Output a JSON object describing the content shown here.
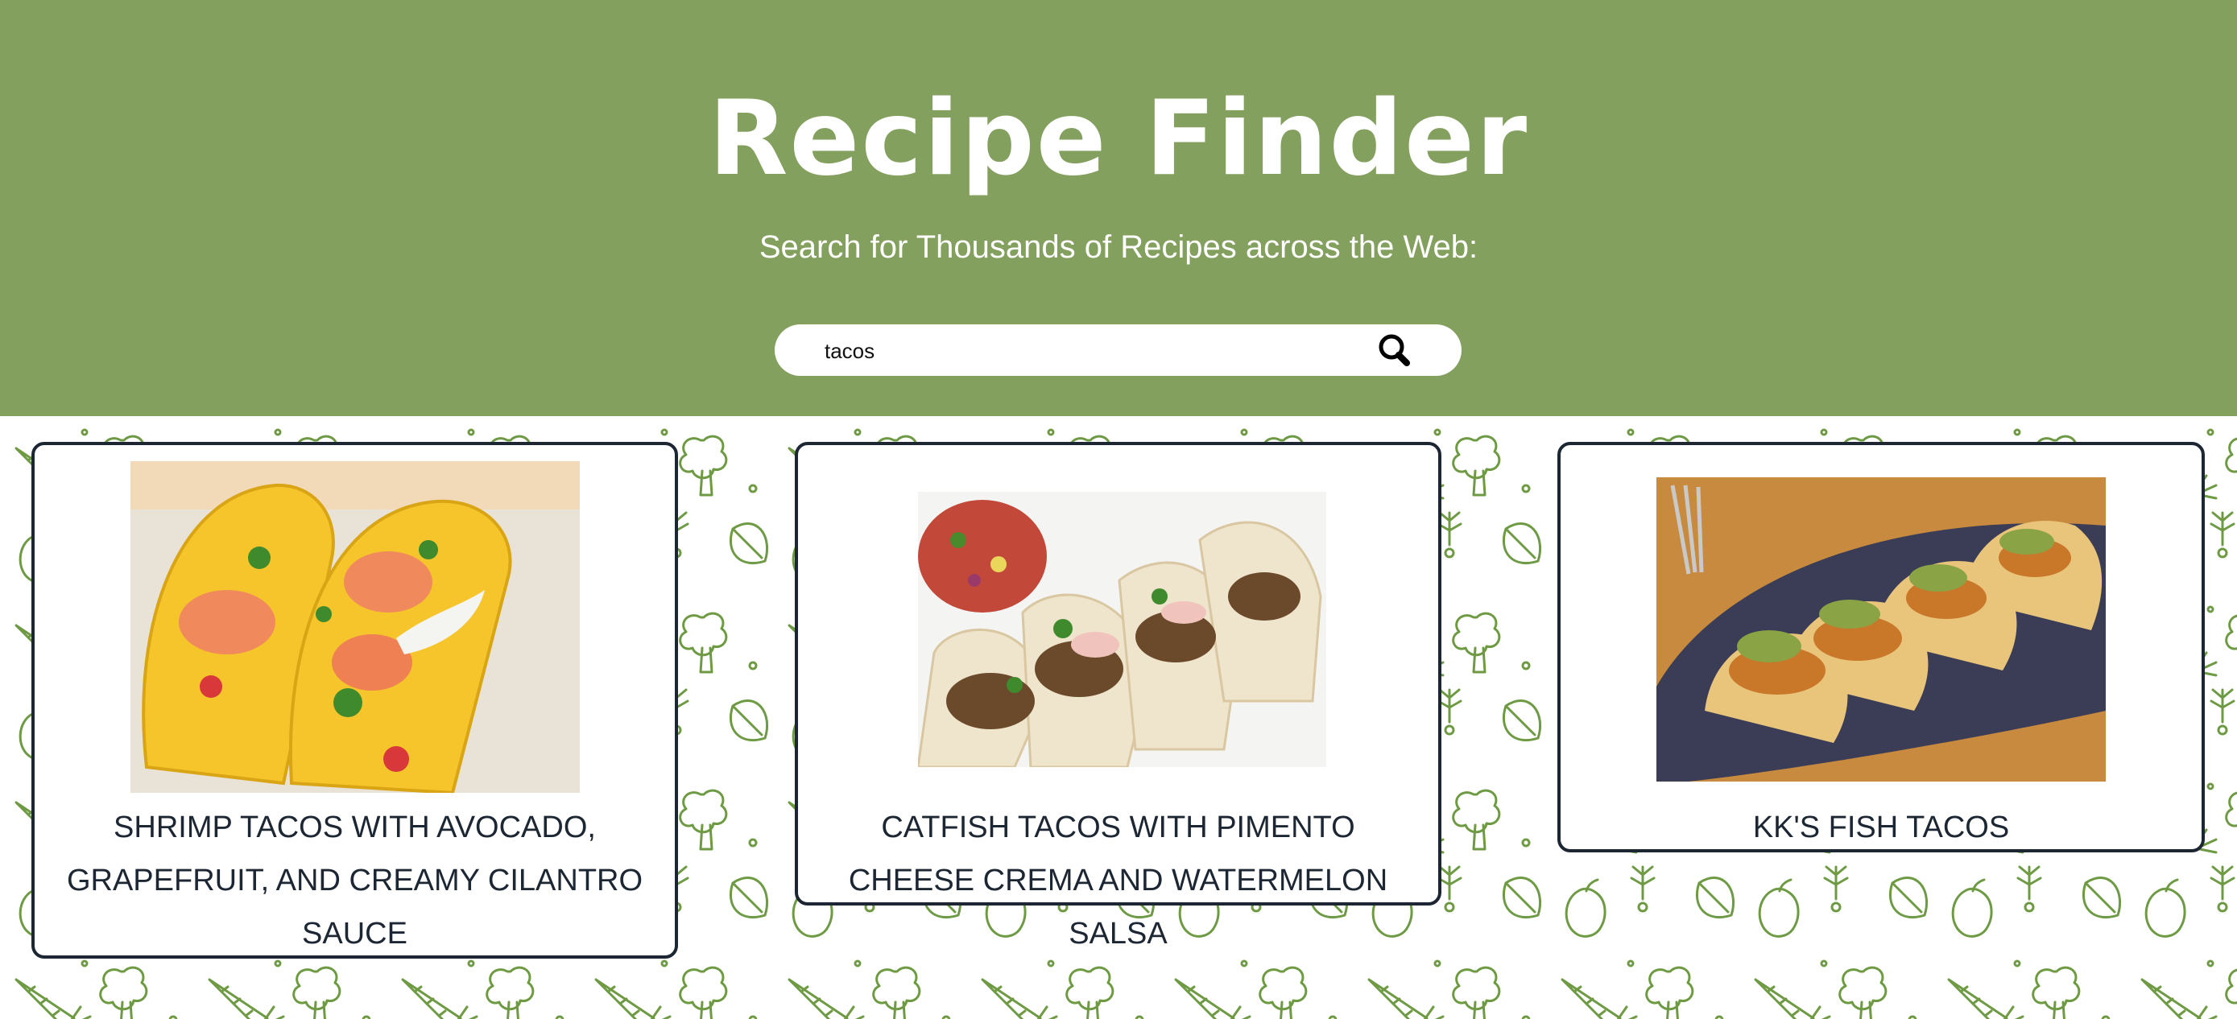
{
  "header": {
    "title": "Recipe Finder",
    "subtitle": "Search for Thousands of Recipes across the Web:"
  },
  "search": {
    "value": "tacos",
    "icon": "search-icon"
  },
  "recipes": [
    {
      "title": "SHRIMP TACOS WITH AVOCADO, GRAPEFRUIT, AND CREAMY CILANTRO SAUCE",
      "image": "shrimp-tacos-photo"
    },
    {
      "title": "CATFISH TACOS WITH PIMENTO CHEESE CREMA AND WATERMELON SALSA",
      "image": "catfish-tacos-photo"
    },
    {
      "title": "KK'S FISH TACOS",
      "image": "fish-tacos-photo"
    }
  ],
  "colors": {
    "header_bg": "#84a05e",
    "pattern_stroke": "#6e9a43",
    "card_border": "#1c2733"
  }
}
